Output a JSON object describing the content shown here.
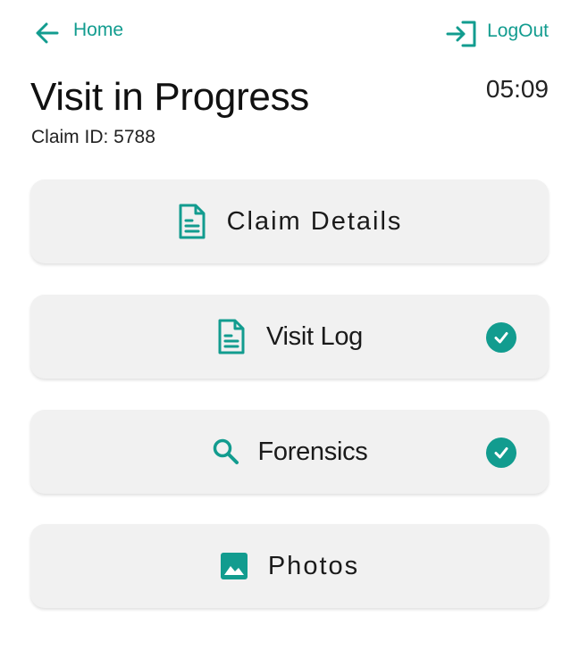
{
  "nav": {
    "home_label": "Home",
    "logout_label": "LogOut"
  },
  "header": {
    "title": "Visit in Progress",
    "timer": "05:09",
    "claim_id": "Claim ID: 5788"
  },
  "cards": [
    {
      "label": "Claim Details",
      "icon": "document-icon",
      "completed": false
    },
    {
      "label": "Visit Log",
      "icon": "document-icon",
      "completed": true
    },
    {
      "label": "Forensics",
      "icon": "search-icon",
      "completed": true
    },
    {
      "label": "Photos",
      "icon": "image-icon",
      "completed": false
    }
  ],
  "colors": {
    "accent": "#129c8f",
    "card_bg": "#f1f1f1",
    "text": "#1a1a1a"
  }
}
